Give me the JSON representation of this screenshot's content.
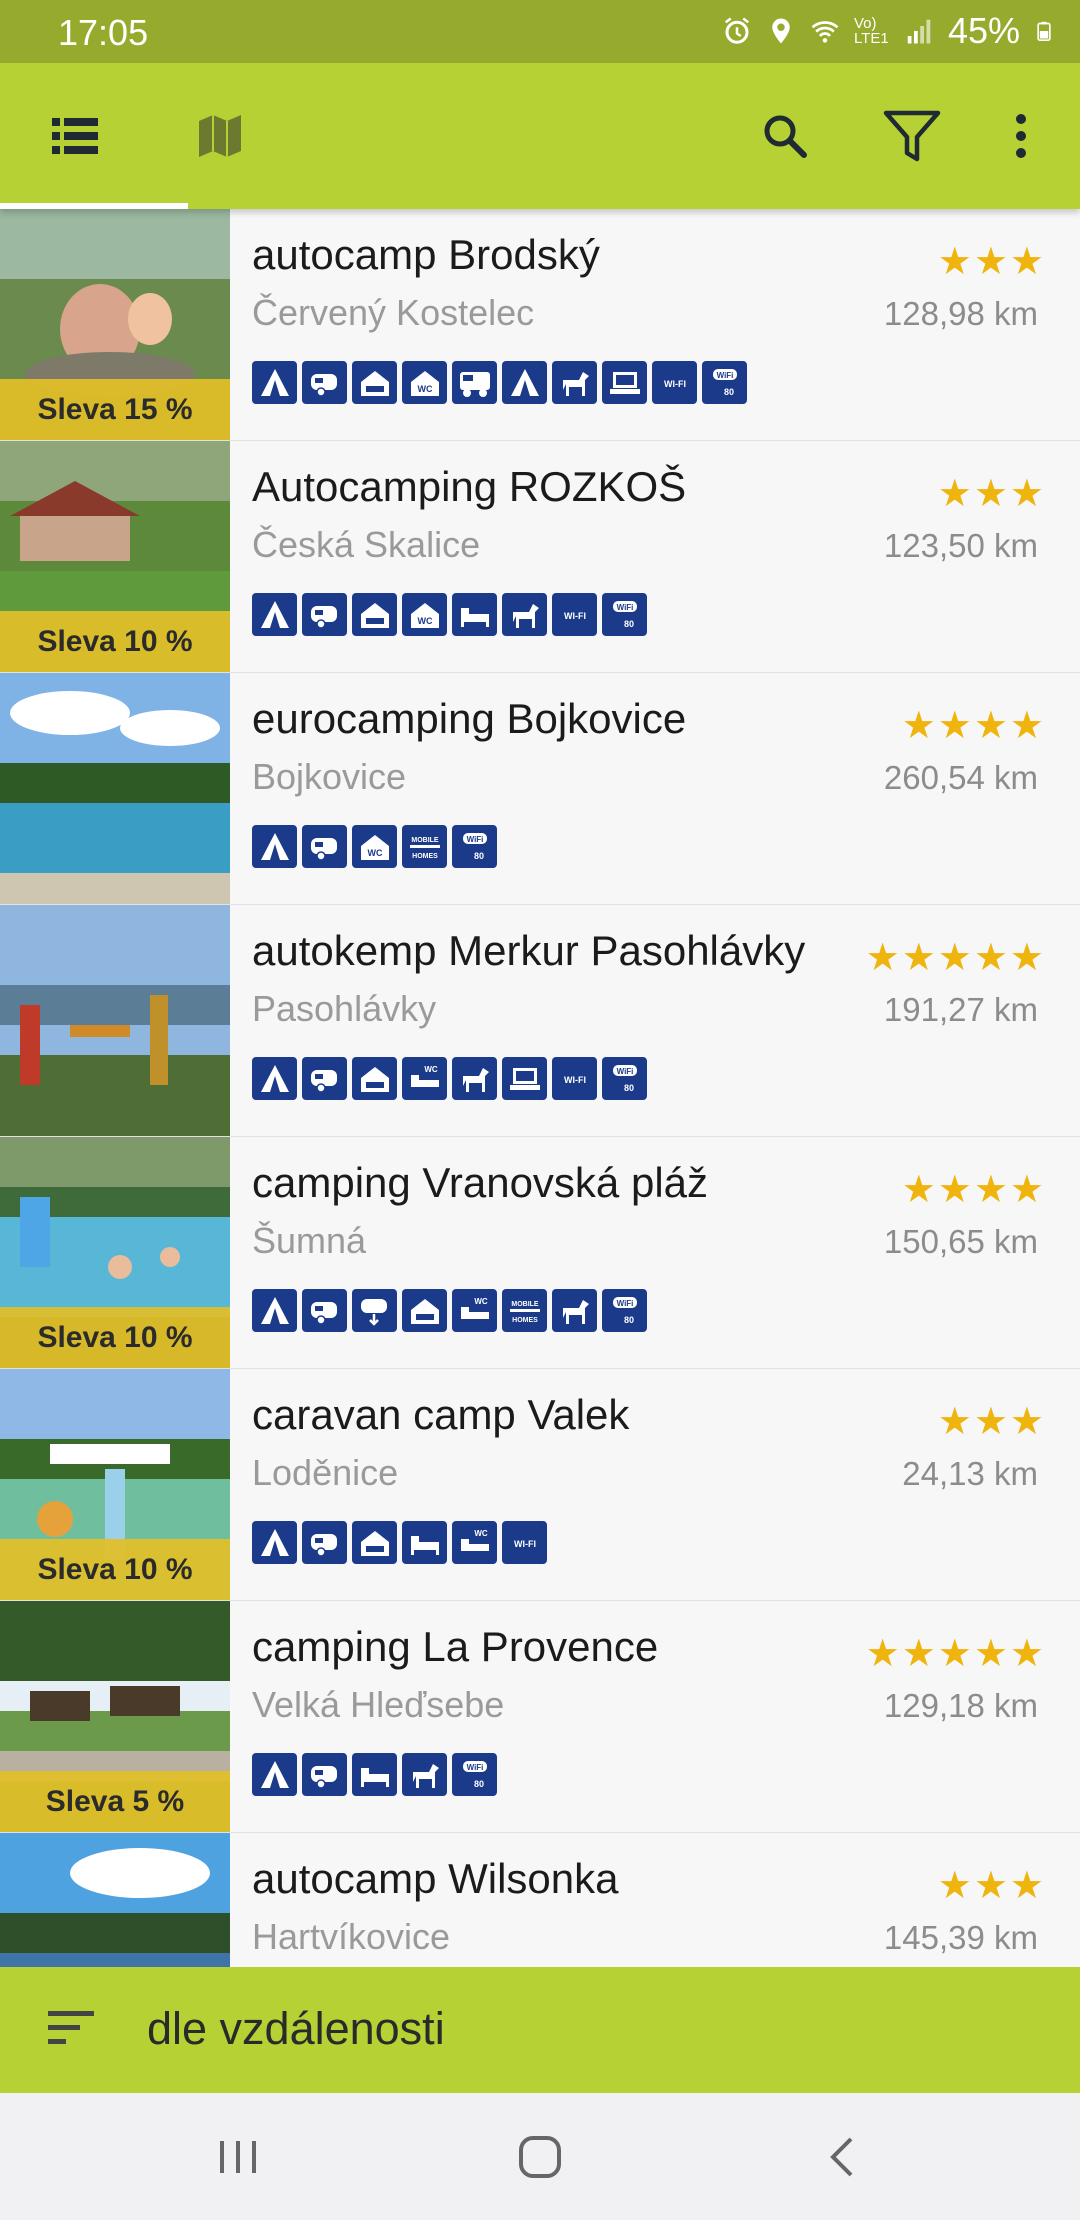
{
  "status_bar": {
    "time": "17:05",
    "network": "Vo) LTE1",
    "battery": "45%"
  },
  "toolbar": {
    "icons": [
      "list-view-icon",
      "map-view-icon",
      "search-icon",
      "filter-icon",
      "more-vert-icon"
    ],
    "accent": "#b5d134"
  },
  "camps": [
    {
      "name": "autocamp Brodský",
      "city": "Červený Kostelec",
      "distance": "128,98 km",
      "stars": "★★★",
      "discount": "Sleva 15 %",
      "amenities": [
        "tent",
        "caravan",
        "house",
        "house-wc",
        "camper",
        "tent",
        "horse",
        "laptop",
        "wifi",
        "wifi-80"
      ]
    },
    {
      "name": "Autocamping ROZKOŠ",
      "city": "Česká Skalice",
      "distance": "123,50 km",
      "stars": "★★★",
      "discount": "Sleva 10 %",
      "amenities": [
        "tent",
        "caravan",
        "house",
        "house-wc",
        "bed",
        "horse",
        "wifi",
        "wifi-80"
      ]
    },
    {
      "name": "eurocamping Bojkovice",
      "city": "Bojkovice",
      "distance": "260,54 km",
      "stars": "★★★★",
      "discount": "",
      "amenities": [
        "tent",
        "caravan",
        "house-wc",
        "mobile-homes",
        "wifi-80"
      ]
    },
    {
      "name": "autokemp Merkur Pasohlávky",
      "city": "Pasohlávky",
      "distance": "191,27 km",
      "stars": "★★★★★",
      "discount": "",
      "amenities": [
        "tent",
        "caravan",
        "house",
        "bed-wc",
        "horse",
        "laptop",
        "wifi",
        "wifi-80"
      ]
    },
    {
      "name": "camping Vranovská pláž",
      "city": "Šumná",
      "distance": "150,65 km",
      "stars": "★★★★",
      "discount": "Sleva 10 %",
      "amenities": [
        "tent",
        "caravan",
        "caravan-dump",
        "house",
        "bed-wc",
        "mobile-homes",
        "horse",
        "wifi-80"
      ]
    },
    {
      "name": "caravan camp Valek",
      "city": "Loděnice",
      "distance": "24,13 km",
      "stars": "★★★",
      "discount": "Sleva 10 %",
      "amenities": [
        "tent",
        "caravan",
        "house",
        "bed",
        "bed-wc",
        "wifi"
      ]
    },
    {
      "name": "camping La Provence",
      "city": "Velká Hleďsebe",
      "distance": "129,18 km",
      "stars": "★★★★★",
      "discount": "Sleva 5 %",
      "amenities": [
        "tent",
        "caravan",
        "bed",
        "horse",
        "wifi-80"
      ]
    },
    {
      "name": "autocamp Wilsonka",
      "city": "Hartvíkovice",
      "distance": "145,39 km",
      "stars": "★★★",
      "discount": "",
      "amenities": []
    }
  ],
  "amenity_labels": {
    "wifi": "WI-FI",
    "wifi-80": "80",
    "mobile-homes": "MOBILE HOMES",
    "wc": "WC"
  },
  "sort_bar": {
    "label": "dle vzdálenosti",
    "icon": "sort-icon"
  },
  "nav_bar": {
    "icons": [
      "recents-icon",
      "home-icon",
      "back-icon"
    ]
  }
}
